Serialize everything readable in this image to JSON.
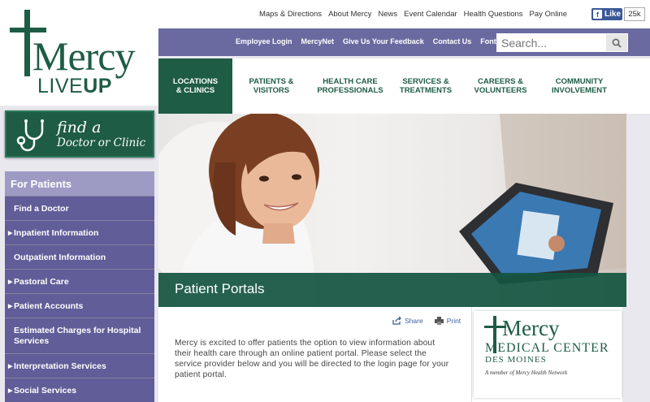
{
  "logo": {
    "wordmark": "Mercy",
    "tagline_light": "LIVE",
    "tagline_bold": "UP"
  },
  "find_doctor": {
    "line1": "find a",
    "line2": "Doctor or Clinic"
  },
  "utility_links": [
    "Maps & Directions",
    "About Mercy",
    "News",
    "Event Calendar",
    "Health Questions",
    "Pay Online"
  ],
  "facebook": {
    "like_label": "Like",
    "count": "25k"
  },
  "secondary_links": [
    "Employee Login",
    "MercyNet",
    "Give Us Your Feedback",
    "Contact Us",
    "Font Size"
  ],
  "search": {
    "placeholder": "Search..."
  },
  "main_nav": [
    "LOCATIONS\n& CLINICS",
    "PATIENTS &\nVISITORS",
    "HEALTH CARE\nPROFESSIONALS",
    "SERVICES &\nTREATMENTS",
    "CAREERS &\nVOLUNTEERS",
    "COMMUNITY\nINVOLVEMENT"
  ],
  "sidebar": {
    "heading": "For Patients",
    "items": [
      {
        "label": "Find a Doctor",
        "expandable": false
      },
      {
        "label": "Inpatient Information",
        "expandable": true
      },
      {
        "label": "Outpatient Information",
        "expandable": false
      },
      {
        "label": "Pastoral Care",
        "expandable": true
      },
      {
        "label": "Patient Accounts",
        "expandable": true
      },
      {
        "label": "Estimated Charges for Hospital Services",
        "expandable": false
      },
      {
        "label": "Interpretation Services",
        "expandable": true
      },
      {
        "label": "Social Services",
        "expandable": true
      }
    ]
  },
  "hero": {
    "title": "Patient Portals"
  },
  "share": {
    "share_label": "Share",
    "print_label": "Print"
  },
  "body": {
    "intro": "Mercy is excited to offer patients the option to view information about their health care through an online patient portal. Please select the service provider below and you will be directed to the login page for your patient portal."
  },
  "promo": {
    "wordmark": "Mercy",
    "subtitle": "MEDICAL CENTER",
    "city": "DES MOINES",
    "network": "A member of Mercy Health Network"
  },
  "colors": {
    "brand_green": "#1e5c45",
    "nav_purple": "#6b6aa0",
    "sidebar_purple": "#615d98",
    "sidebar_head": "#9d9bc4"
  }
}
